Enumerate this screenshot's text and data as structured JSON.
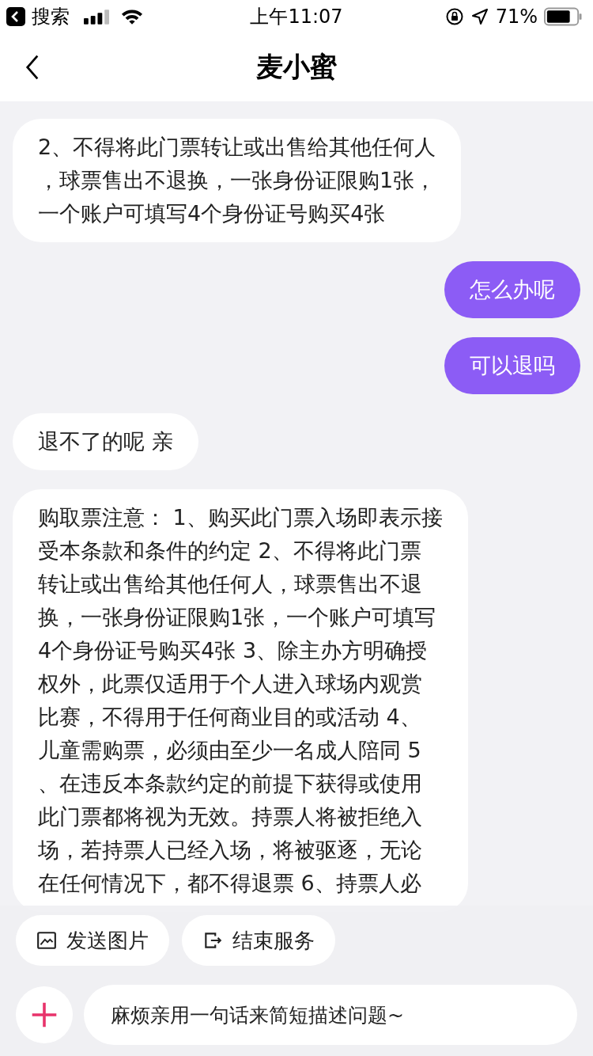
{
  "status_bar": {
    "back_app": "搜索",
    "time": "上午11:07",
    "battery": "71%"
  },
  "nav": {
    "title": "麦小蜜"
  },
  "messages": [
    {
      "kind": "agent",
      "lines": [
        "2、不得将此门票转让或出售给其他任何人",
        "，球票售出不退换，一张身份证限购1张，",
        "一个账户可填写4个身份证号购买4张"
      ]
    },
    {
      "kind": "user",
      "lines": [
        "怎么办呢"
      ]
    },
    {
      "kind": "user",
      "lines": [
        "可以退吗"
      ]
    },
    {
      "kind": "agent",
      "lines": [
        "退不了的呢 亲"
      ]
    },
    {
      "kind": "agent",
      "lines": [
        "购取票注意： 1、购买此门票入场即表示接",
        "受本条款和条件的约定 2、不得将此门票",
        "转让或出售给其他任何人，球票售出不退",
        "换，一张身份证限购1张，一个账户可填写",
        "4个身份证号购买4张 3、除主办方明确授",
        "权外，此票仅适用于个人进入球场内观赏",
        "比赛，不得用于任何商业目的或活动 4、",
        "儿童需购票，必须由至少一名成人陪同 5",
        "、在违反本条款约定的前提下获得或使用",
        "此门票都将视为无效。持票人将被拒绝入",
        "场，若持票人已经入场，将被驱逐，无论",
        "在任何情况下，都不得退票 6、持票人必"
      ]
    }
  ],
  "quick_actions": [
    {
      "kind": "image",
      "label": "发送图片"
    },
    {
      "kind": "exit",
      "label": "结束服务"
    }
  ],
  "input": {
    "placeholder": "麻烦亲用一句话来简短描述问题~"
  }
}
